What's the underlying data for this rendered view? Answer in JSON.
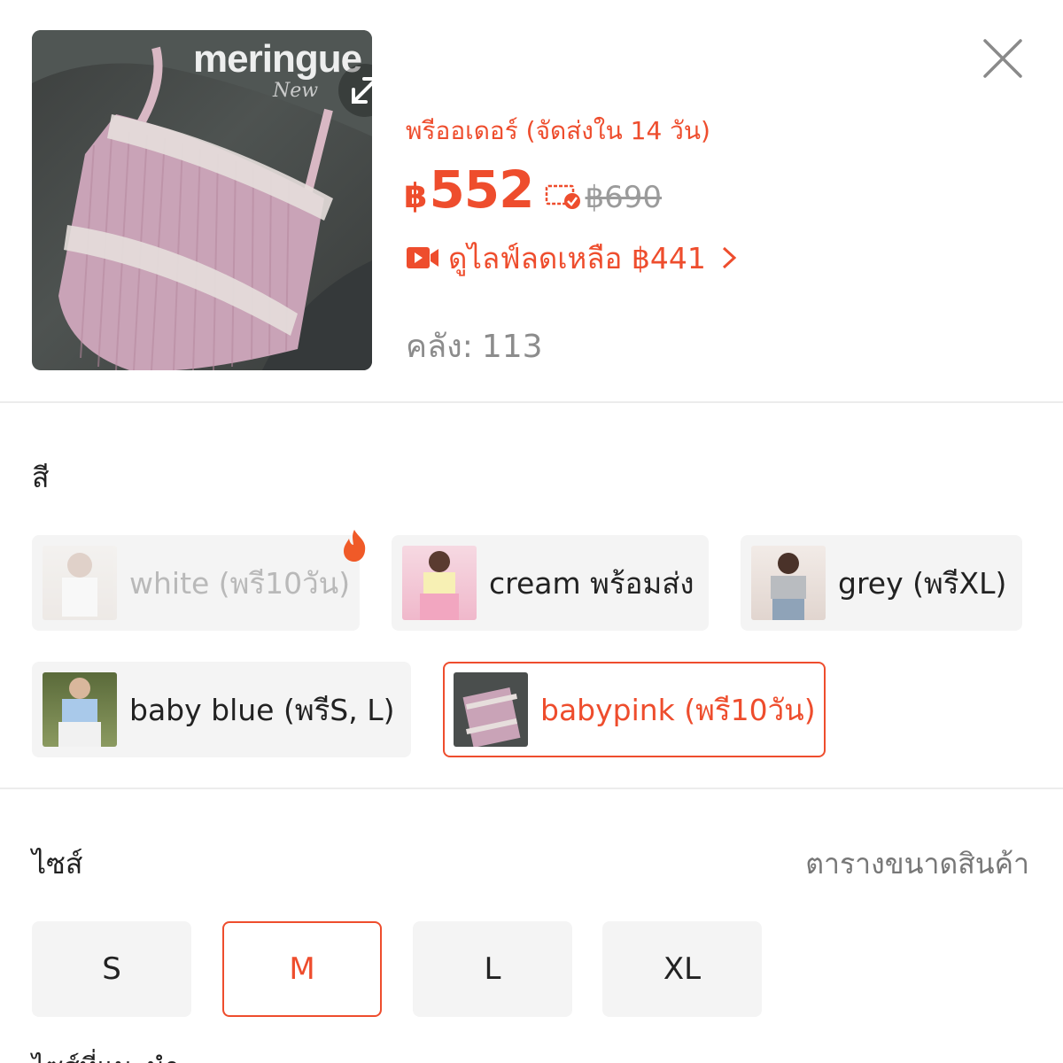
{
  "product": {
    "image_brand": "meringue",
    "image_brand_sub": "New",
    "preorder_text": "พรีออเดอร์ (จัดส่งใน 14 วัน)",
    "price_currency": "฿",
    "price": "552",
    "original_price": "฿690",
    "live_text": "ดูไลฟ์ลดเหลือ ฿441",
    "stock_label": "คลัง:",
    "stock_value": "113"
  },
  "color_section": {
    "title": "สี",
    "options": [
      {
        "label": "white (พรี10วัน)",
        "state": "disabled",
        "hot": true
      },
      {
        "label": "cream พร้อมส่ง",
        "state": "normal",
        "hot": false
      },
      {
        "label": "grey (พรีXL)",
        "state": "normal",
        "hot": false
      },
      {
        "label": "baby blue (พรีS, L)",
        "state": "normal",
        "hot": false
      },
      {
        "label": "babypink (พรี10วัน)",
        "state": "selected",
        "hot": false
      }
    ]
  },
  "size_section": {
    "title": "ไซส์",
    "size_guide_label": "ตารางขนาดสินค้า",
    "options": [
      {
        "label": "S",
        "state": "normal"
      },
      {
        "label": "M",
        "state": "selected"
      },
      {
        "label": "L",
        "state": "normal"
      },
      {
        "label": "XL",
        "state": "normal"
      }
    ]
  },
  "footer_partial": "ไซส์ที่แนะนำ",
  "colors": {
    "accent": "#ee4d2d",
    "chip_bg": "#f4f4f4",
    "muted_text": "#8c8c8c"
  },
  "icons": [
    "expand-icon",
    "close-icon",
    "voucher-icon",
    "live-video-icon",
    "chevron-right-icon",
    "hot-flame-icon"
  ]
}
